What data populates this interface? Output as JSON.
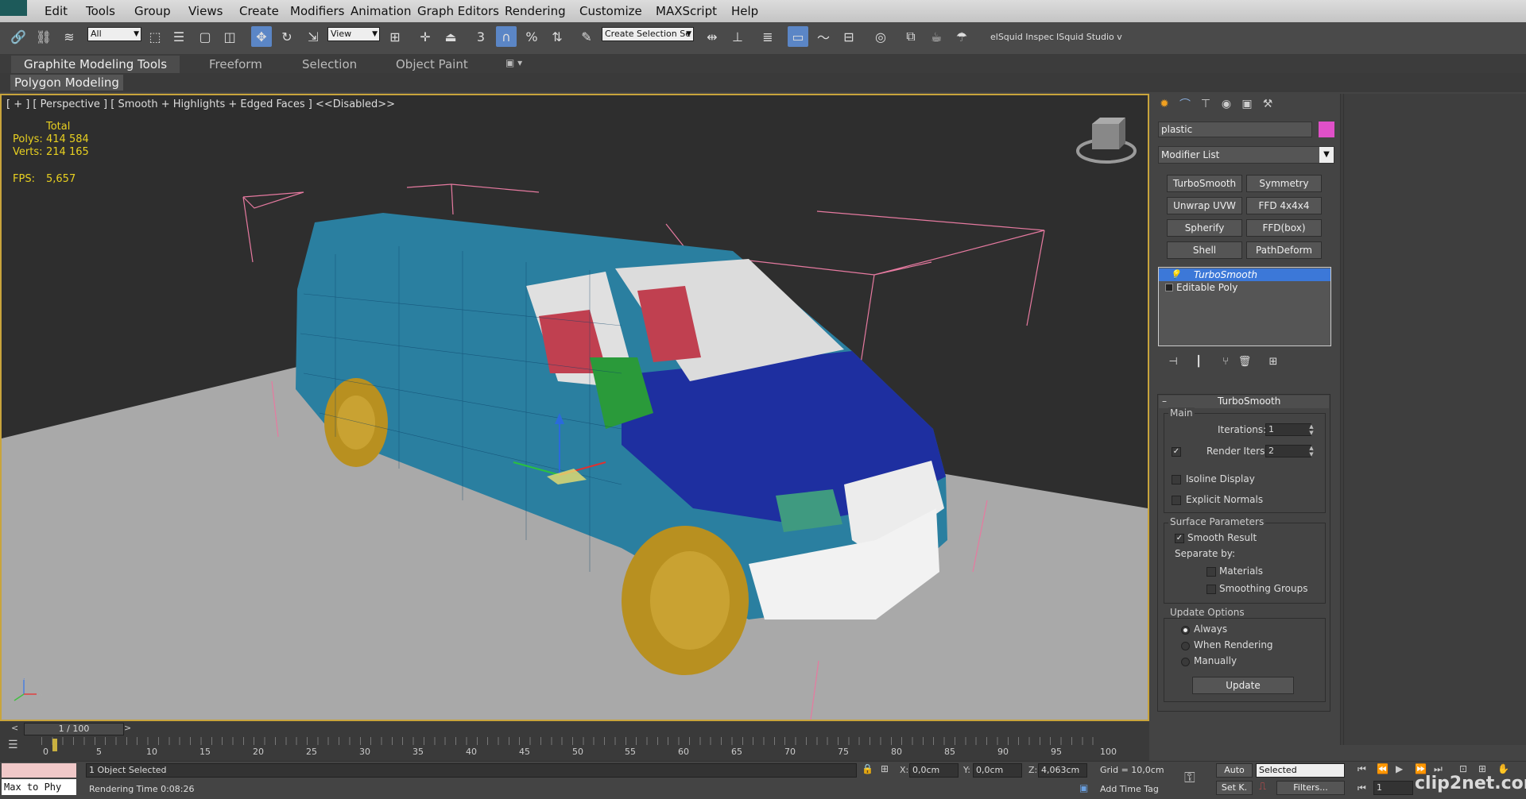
{
  "menu": [
    "Edit",
    "Tools",
    "Group",
    "Views",
    "Create",
    "Modifiers",
    "Animation",
    "Graph Editors",
    "Rendering",
    "Customize",
    "MAXScript",
    "Help"
  ],
  "toolbar": {
    "filter": "All",
    "ref_coord": "View",
    "selection_set_placeholder": "Create Selection Se",
    "plugin1": "elSquid Inspec",
    "plugin2": "ISquid Studio v"
  },
  "ribbon": {
    "tabs": [
      "Graphite Modeling Tools",
      "Freeform",
      "Selection",
      "Object Paint"
    ],
    "sub": "Polygon Modeling"
  },
  "viewport": {
    "label": "[ + ] [ Perspective ] [ Smooth + Highlights + Edged Faces ] <<Disabled>>",
    "stats": {
      "total": "Total",
      "polys_label": "Polys:",
      "polys": "414 584",
      "verts_label": "Verts:",
      "verts": "214 165",
      "fps_label": "FPS:",
      "fps": "5,657"
    },
    "axis_x": "x",
    "axis_y": "y",
    "axis_z": "z"
  },
  "command_panel": {
    "object_name": "plastic",
    "object_color": "#e050c8",
    "modifier_list": "Modifier List",
    "modifier_buttons": [
      "TurboSmooth",
      "Symmetry",
      "Unwrap UVW",
      "FFD 4x4x4",
      "Spherify",
      "FFD(box)",
      "Shell",
      "PathDeform"
    ],
    "stack": [
      "TurboSmooth",
      "Editable Poly"
    ],
    "rollout_title": "TurboSmooth",
    "main_group": "Main",
    "iterations_label": "Iterations:",
    "iterations": "1",
    "render_iters_label": "Render Iters:",
    "render_iters": "2",
    "isoline_display": "Isoline Display",
    "explicit_normals": "Explicit Normals",
    "surface_group": "Surface Parameters",
    "smooth_result": "Smooth Result",
    "separate_by": "Separate by:",
    "materials": "Materials",
    "smoothing_groups": "Smoothing Groups",
    "update_group": "Update Options",
    "always": "Always",
    "when_rendering": "When Rendering",
    "manually": "Manually",
    "update_button": "Update"
  },
  "timeline": {
    "frame": "1 / 100",
    "ticks": [
      "0",
      "5",
      "10",
      "15",
      "20",
      "25",
      "30",
      "35",
      "40",
      "45",
      "50",
      "55",
      "60",
      "65",
      "70",
      "75",
      "80",
      "85",
      "90",
      "95",
      "100"
    ]
  },
  "status": {
    "maxscript": "Max to Phy",
    "selection": "1 Object Selected",
    "render_time": "Rendering Time  0:08:26",
    "x_label": "X:",
    "x": "0,0cm",
    "y_label": "Y:",
    "y": "0,0cm",
    "z_label": "Z:",
    "z": "4,063cm",
    "grid": "Grid = 10,0cm",
    "add_time_tag": "Add Time Tag",
    "auto": "Auto",
    "selected": "Selected",
    "setk": "Set K.",
    "filters": "Filters...",
    "current_frame": "1",
    "watermark": "clip2net.com"
  }
}
